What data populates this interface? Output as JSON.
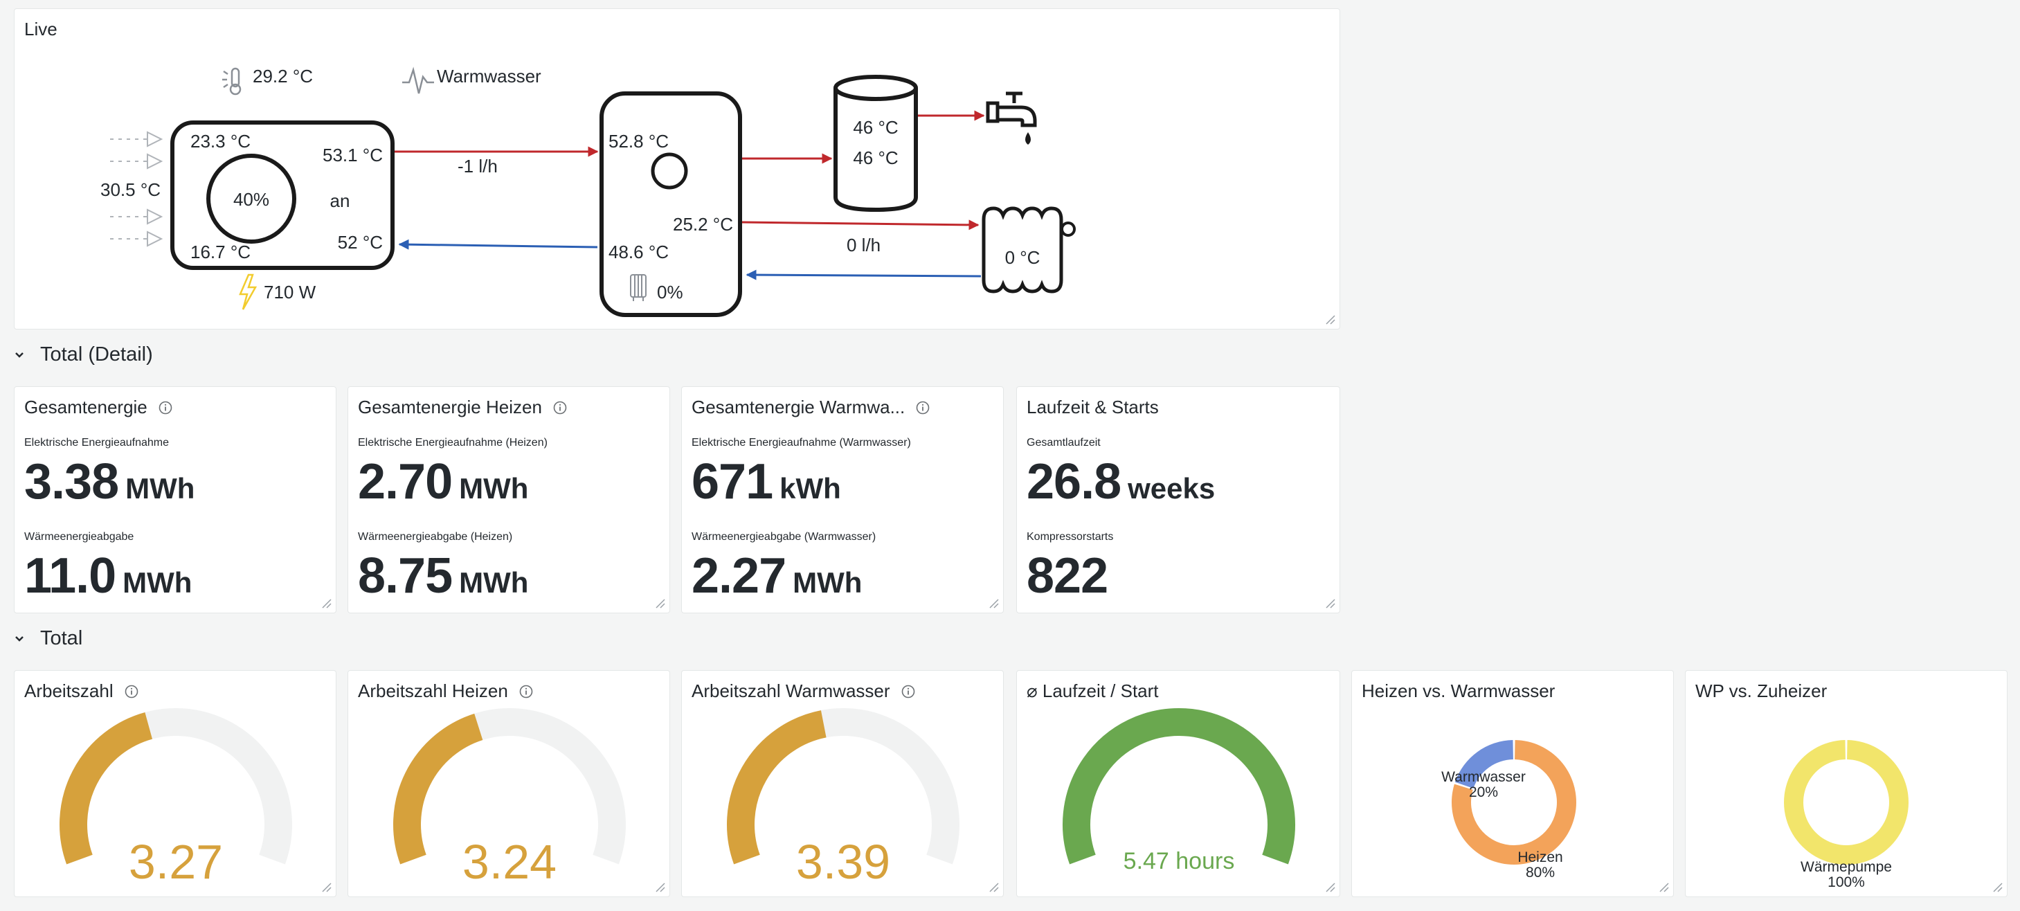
{
  "live": {
    "title": "Live",
    "outdoor_temp": "29.2 °C",
    "mode": "Warmwasser",
    "hp_in_temp": "23.3 °C",
    "hp_out_temp": "53.1 °C",
    "hp_return_temp": "52 °C",
    "hp_low_temp": "16.7 °C",
    "hp_side_temp": "30.5 °C",
    "compressor": "40%",
    "status": "an",
    "flow_top": "-1 l/h",
    "power": "710 W",
    "storage_top_temp": "52.8 °C",
    "storage_mid_temp": "25.2 °C",
    "storage_bottom_temp": "48.6 °C",
    "heater_pct": "0%",
    "tank_temp_1": "46 °C",
    "tank_temp_2": "46 °C",
    "flow_bottom": "0 l/h",
    "radiator_temp": "0 °C"
  },
  "row_detail": {
    "title": "Total (Detail)"
  },
  "row_total": {
    "title": "Total"
  },
  "stats": [
    {
      "title": "Gesamtenergie",
      "label1": "Elektrische Energieaufnahme",
      "value1": "3.38",
      "unit1": "MWh",
      "label2": "Wärmeenergieabgabe",
      "value2": "11.0",
      "unit2": "MWh"
    },
    {
      "title": "Gesamtenergie Heizen",
      "label1": "Elektrische Energieaufnahme (Heizen)",
      "value1": "2.70",
      "unit1": "MWh",
      "label2": "Wärmeenergieabgabe (Heizen)",
      "value2": "8.75",
      "unit2": "MWh"
    },
    {
      "title": "Gesamtenergie Warmwa...",
      "label1": "Elektrische Energieaufnahme (Warmwasser)",
      "value1": "671",
      "unit1": "kWh",
      "label2": "Wärmeenergieabgabe (Warmwasser)",
      "value2": "2.27",
      "unit2": "MWh"
    },
    {
      "title": "Laufzeit & Starts",
      "label1": "Gesamtlaufzeit",
      "value1": "26.8",
      "unit1": "weeks",
      "label2": "Kompressorstarts",
      "value2": "822",
      "unit2": ""
    }
  ],
  "gauges": [
    {
      "title": "Arbeitszahl",
      "value": 3.27,
      "display": "3.27",
      "fraction": 0.43,
      "color": "#d6a13c"
    },
    {
      "title": "Arbeitszahl Heizen",
      "value": 3.24,
      "display": "3.24",
      "fraction": 0.42,
      "color": "#d6a13c"
    },
    {
      "title": "Arbeitszahl Warmwasser",
      "value": 3.39,
      "display": "3.39",
      "fraction": 0.45,
      "color": "#d6a13c"
    },
    {
      "title": "⌀ Laufzeit / Start",
      "value": 5.47,
      "display": "5.47 hours",
      "fraction": 1.0,
      "color": "#6aa84f"
    }
  ],
  "donut_hw": {
    "title": "Heizen vs. Warmwasser",
    "slices": [
      {
        "name": "Warmwasser",
        "percent": 20,
        "pct_label": "20%",
        "color": "#6f8fda"
      },
      {
        "name": "Heizen",
        "percent": 80,
        "pct_label": "80%",
        "color": "#f3a35a"
      }
    ]
  },
  "donut_wp": {
    "title": "WP vs. Zuheizer",
    "slices": [
      {
        "name": "Wärmepumpe",
        "percent": 100,
        "pct_label": "100%",
        "color": "#f2e56b"
      }
    ]
  },
  "colors": {
    "hot_pipe": "#c0282c",
    "cold_pipe": "#2b5fb4",
    "info_icon": "#6b6f73"
  }
}
